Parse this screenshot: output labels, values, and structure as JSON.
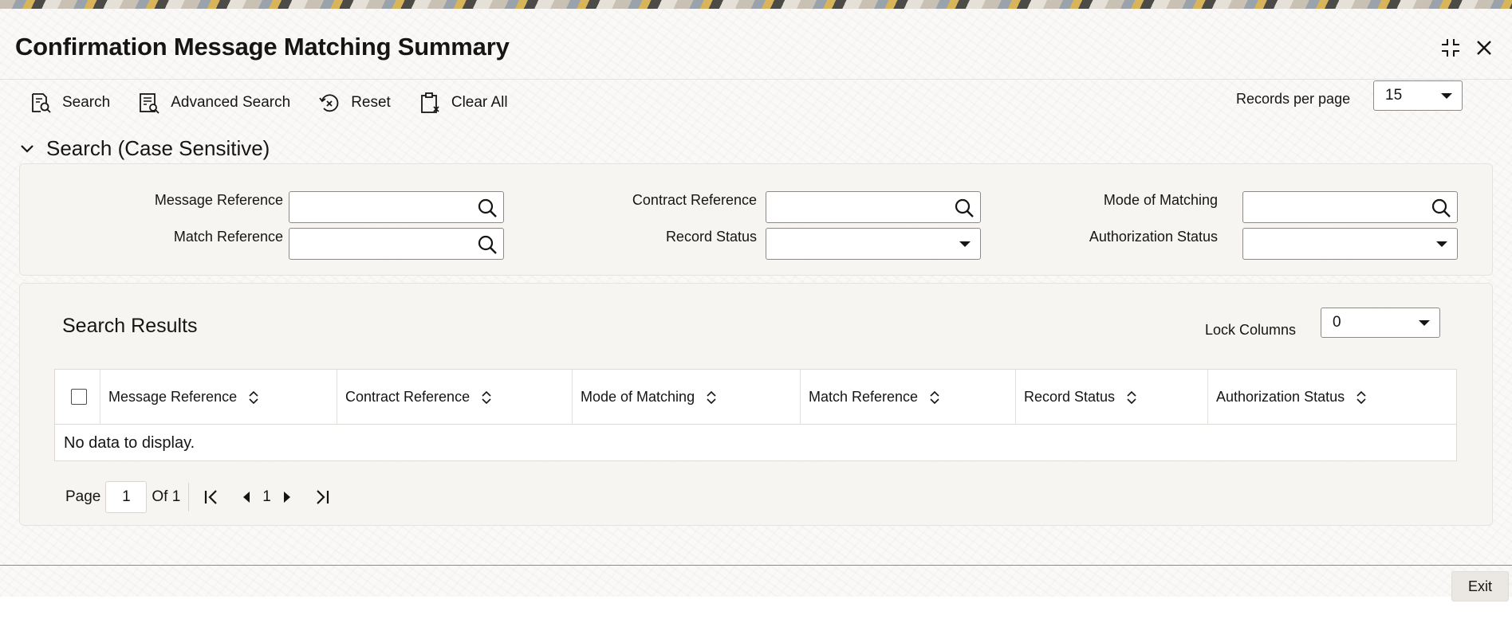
{
  "window": {
    "title": "Confirmation Message Matching Summary"
  },
  "toolbar": {
    "search_label": "Search",
    "advanced_search_label": "Advanced Search",
    "reset_label": "Reset",
    "clear_all_label": "Clear All",
    "records_per_page_label": "Records per page",
    "records_per_page_value": "15"
  },
  "search_section": {
    "header": "Search (Case Sensitive)",
    "fields": {
      "message_reference": {
        "label": "Message Reference",
        "value": ""
      },
      "contract_reference": {
        "label": "Contract Reference",
        "value": ""
      },
      "mode_of_matching": {
        "label": "Mode of Matching",
        "value": ""
      },
      "match_reference": {
        "label": "Match Reference",
        "value": ""
      },
      "record_status": {
        "label": "Record Status",
        "value": ""
      },
      "authorization_status": {
        "label": "Authorization Status",
        "value": ""
      }
    }
  },
  "results": {
    "title": "Search Results",
    "lock_columns_label": "Lock Columns",
    "lock_columns_value": "0",
    "columns": [
      "Message Reference",
      "Contract Reference",
      "Mode of Matching",
      "Match Reference",
      "Record Status",
      "Authorization Status"
    ],
    "empty_message": "No data to display."
  },
  "pager": {
    "page_label": "Page",
    "current_page": "1",
    "of_label": "Of 1",
    "page_number": "1"
  },
  "footer": {
    "exit_label": "Exit"
  },
  "colors": {
    "text": "#161513",
    "border": "#8d8985",
    "panel": "#f6f4f1",
    "background": "#fbf9f8"
  }
}
